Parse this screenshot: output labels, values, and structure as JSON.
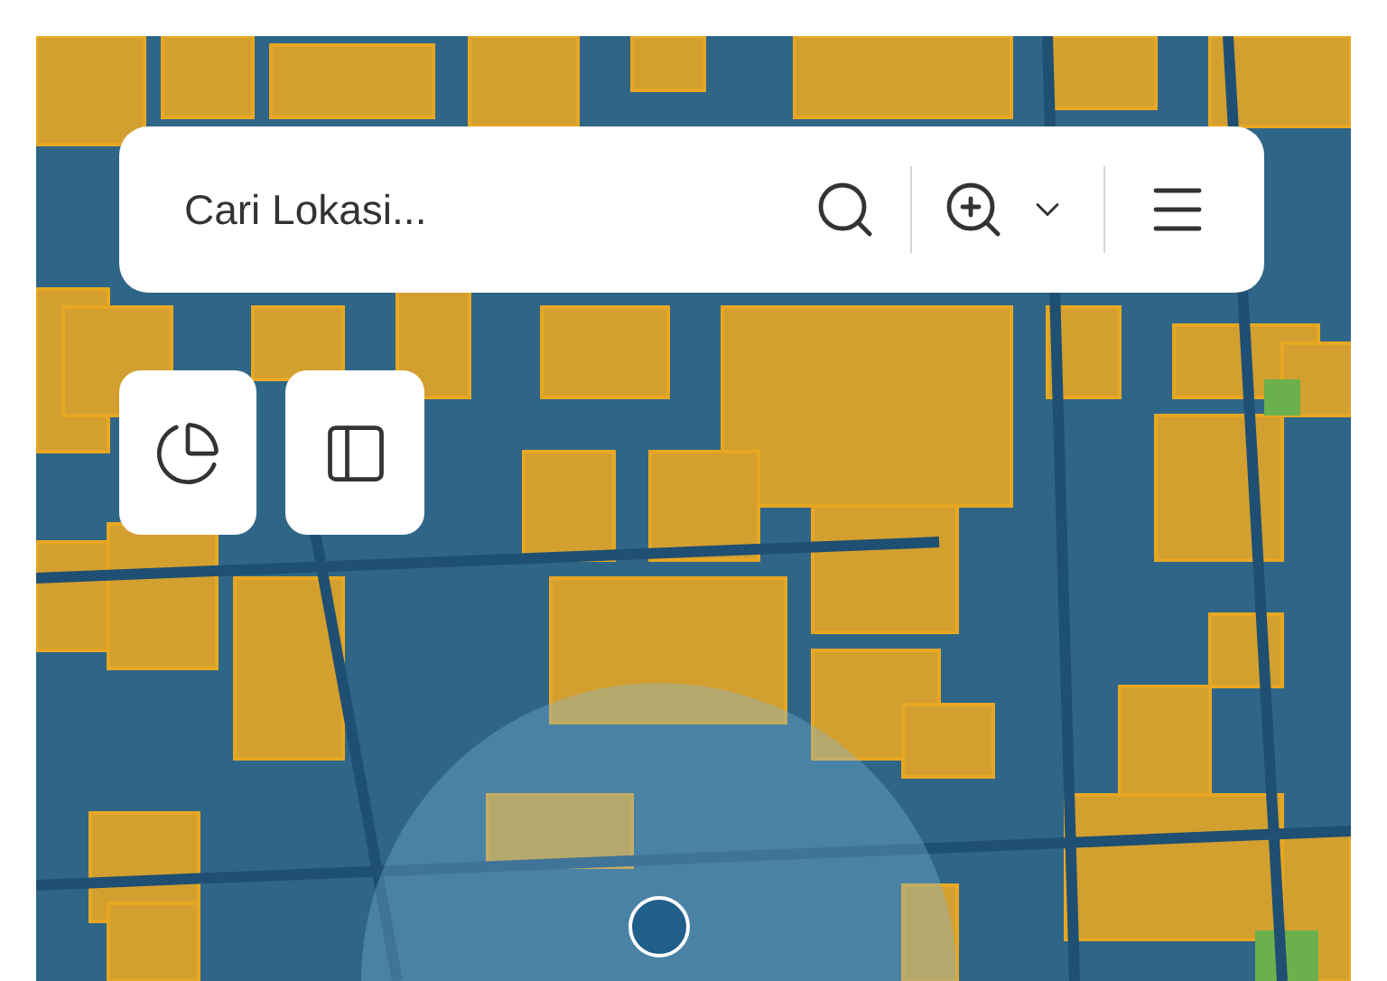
{
  "search": {
    "placeholder": "Cari Lokasi..."
  }
}
